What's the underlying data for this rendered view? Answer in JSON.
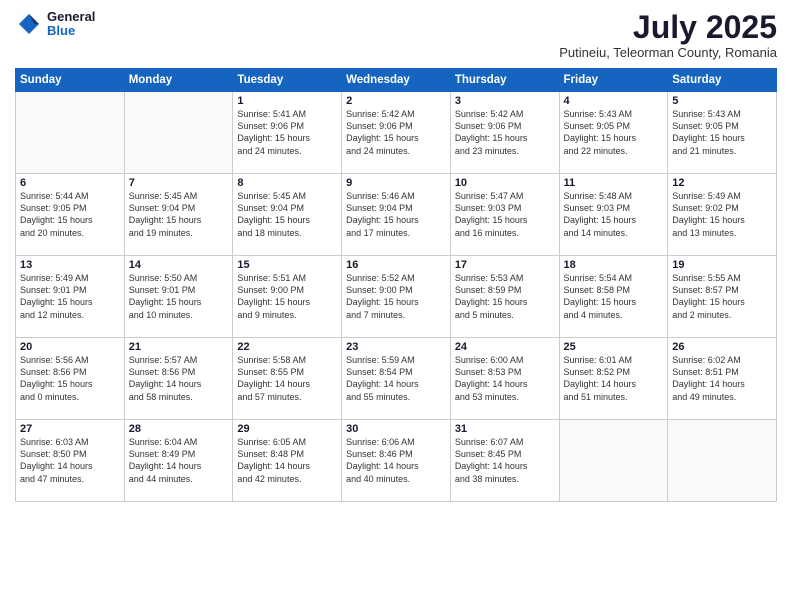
{
  "header": {
    "logo_general": "General",
    "logo_blue": "Blue",
    "month_title": "July 2025",
    "location": "Putineiu, Teleorman County, Romania"
  },
  "weekdays": [
    "Sunday",
    "Monday",
    "Tuesday",
    "Wednesday",
    "Thursday",
    "Friday",
    "Saturday"
  ],
  "weeks": [
    [
      {
        "day": "",
        "info": ""
      },
      {
        "day": "",
        "info": ""
      },
      {
        "day": "1",
        "info": "Sunrise: 5:41 AM\nSunset: 9:06 PM\nDaylight: 15 hours\nand 24 minutes."
      },
      {
        "day": "2",
        "info": "Sunrise: 5:42 AM\nSunset: 9:06 PM\nDaylight: 15 hours\nand 24 minutes."
      },
      {
        "day": "3",
        "info": "Sunrise: 5:42 AM\nSunset: 9:06 PM\nDaylight: 15 hours\nand 23 minutes."
      },
      {
        "day": "4",
        "info": "Sunrise: 5:43 AM\nSunset: 9:05 PM\nDaylight: 15 hours\nand 22 minutes."
      },
      {
        "day": "5",
        "info": "Sunrise: 5:43 AM\nSunset: 9:05 PM\nDaylight: 15 hours\nand 21 minutes."
      }
    ],
    [
      {
        "day": "6",
        "info": "Sunrise: 5:44 AM\nSunset: 9:05 PM\nDaylight: 15 hours\nand 20 minutes."
      },
      {
        "day": "7",
        "info": "Sunrise: 5:45 AM\nSunset: 9:04 PM\nDaylight: 15 hours\nand 19 minutes."
      },
      {
        "day": "8",
        "info": "Sunrise: 5:45 AM\nSunset: 9:04 PM\nDaylight: 15 hours\nand 18 minutes."
      },
      {
        "day": "9",
        "info": "Sunrise: 5:46 AM\nSunset: 9:04 PM\nDaylight: 15 hours\nand 17 minutes."
      },
      {
        "day": "10",
        "info": "Sunrise: 5:47 AM\nSunset: 9:03 PM\nDaylight: 15 hours\nand 16 minutes."
      },
      {
        "day": "11",
        "info": "Sunrise: 5:48 AM\nSunset: 9:03 PM\nDaylight: 15 hours\nand 14 minutes."
      },
      {
        "day": "12",
        "info": "Sunrise: 5:49 AM\nSunset: 9:02 PM\nDaylight: 15 hours\nand 13 minutes."
      }
    ],
    [
      {
        "day": "13",
        "info": "Sunrise: 5:49 AM\nSunset: 9:01 PM\nDaylight: 15 hours\nand 12 minutes."
      },
      {
        "day": "14",
        "info": "Sunrise: 5:50 AM\nSunset: 9:01 PM\nDaylight: 15 hours\nand 10 minutes."
      },
      {
        "day": "15",
        "info": "Sunrise: 5:51 AM\nSunset: 9:00 PM\nDaylight: 15 hours\nand 9 minutes."
      },
      {
        "day": "16",
        "info": "Sunrise: 5:52 AM\nSunset: 9:00 PM\nDaylight: 15 hours\nand 7 minutes."
      },
      {
        "day": "17",
        "info": "Sunrise: 5:53 AM\nSunset: 8:59 PM\nDaylight: 15 hours\nand 5 minutes."
      },
      {
        "day": "18",
        "info": "Sunrise: 5:54 AM\nSunset: 8:58 PM\nDaylight: 15 hours\nand 4 minutes."
      },
      {
        "day": "19",
        "info": "Sunrise: 5:55 AM\nSunset: 8:57 PM\nDaylight: 15 hours\nand 2 minutes."
      }
    ],
    [
      {
        "day": "20",
        "info": "Sunrise: 5:56 AM\nSunset: 8:56 PM\nDaylight: 15 hours\nand 0 minutes."
      },
      {
        "day": "21",
        "info": "Sunrise: 5:57 AM\nSunset: 8:56 PM\nDaylight: 14 hours\nand 58 minutes."
      },
      {
        "day": "22",
        "info": "Sunrise: 5:58 AM\nSunset: 8:55 PM\nDaylight: 14 hours\nand 57 minutes."
      },
      {
        "day": "23",
        "info": "Sunrise: 5:59 AM\nSunset: 8:54 PM\nDaylight: 14 hours\nand 55 minutes."
      },
      {
        "day": "24",
        "info": "Sunrise: 6:00 AM\nSunset: 8:53 PM\nDaylight: 14 hours\nand 53 minutes."
      },
      {
        "day": "25",
        "info": "Sunrise: 6:01 AM\nSunset: 8:52 PM\nDaylight: 14 hours\nand 51 minutes."
      },
      {
        "day": "26",
        "info": "Sunrise: 6:02 AM\nSunset: 8:51 PM\nDaylight: 14 hours\nand 49 minutes."
      }
    ],
    [
      {
        "day": "27",
        "info": "Sunrise: 6:03 AM\nSunset: 8:50 PM\nDaylight: 14 hours\nand 47 minutes."
      },
      {
        "day": "28",
        "info": "Sunrise: 6:04 AM\nSunset: 8:49 PM\nDaylight: 14 hours\nand 44 minutes."
      },
      {
        "day": "29",
        "info": "Sunrise: 6:05 AM\nSunset: 8:48 PM\nDaylight: 14 hours\nand 42 minutes."
      },
      {
        "day": "30",
        "info": "Sunrise: 6:06 AM\nSunset: 8:46 PM\nDaylight: 14 hours\nand 40 minutes."
      },
      {
        "day": "31",
        "info": "Sunrise: 6:07 AM\nSunset: 8:45 PM\nDaylight: 14 hours\nand 38 minutes."
      },
      {
        "day": "",
        "info": ""
      },
      {
        "day": "",
        "info": ""
      }
    ]
  ]
}
